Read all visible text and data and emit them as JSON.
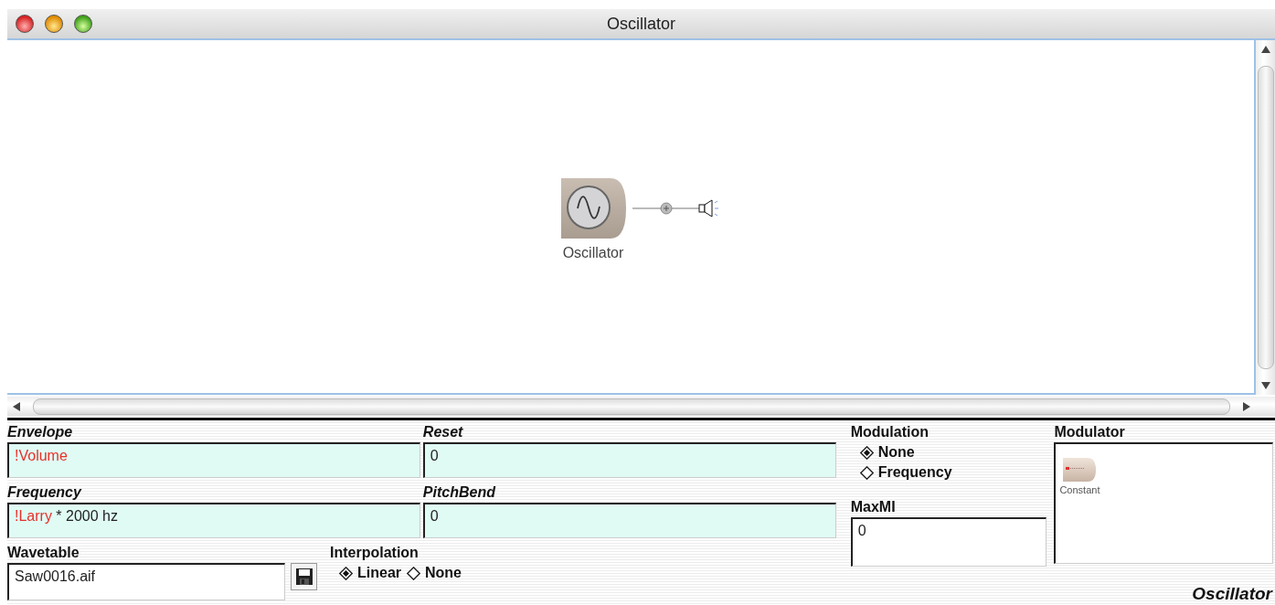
{
  "window": {
    "title": "Oscillator"
  },
  "canvas": {
    "modules": [
      {
        "kind": "oscillator",
        "label": "Oscillator"
      }
    ]
  },
  "parameters": {
    "rows": [
      {
        "fields": [
          {
            "kind": "expression",
            "label": "Envelope",
            "value": [
              {
                "kind": "variable",
                "text": "!Volume"
              }
            ]
          },
          {
            "kind": "expression",
            "label": "Reset",
            "value": [
              {
                "kind": "plain",
                "text": "0"
              }
            ]
          }
        ]
      },
      {
        "fields": [
          {
            "kind": "expression",
            "label": "Frequency",
            "value": [
              {
                "kind": "variable",
                "text": "!Larry"
              },
              {
                "kind": "plain",
                "text": " * 2000 hz"
              }
            ]
          },
          {
            "kind": "expression",
            "label": "PitchBend",
            "value": [
              {
                "kind": "plain",
                "text": "0"
              }
            ]
          }
        ]
      }
    ],
    "wavetable": {
      "label": "Wavetable",
      "value": "Saw0016.aif"
    },
    "interpolation": {
      "label": "Interpolation",
      "options": [
        {
          "label": "Linear",
          "selected": true
        },
        {
          "label": "None",
          "selected": false
        }
      ]
    },
    "modulation": {
      "label": "Modulation",
      "options": [
        {
          "label": "None",
          "selected": true
        },
        {
          "label": "Frequency",
          "selected": false
        }
      ]
    },
    "max_mi": {
      "label": "MaxMI",
      "value": "0"
    },
    "modulator": {
      "label": "Modulator",
      "module": {
        "kind": "constant",
        "label": "Constant"
      }
    },
    "footer": "Oscillator"
  }
}
